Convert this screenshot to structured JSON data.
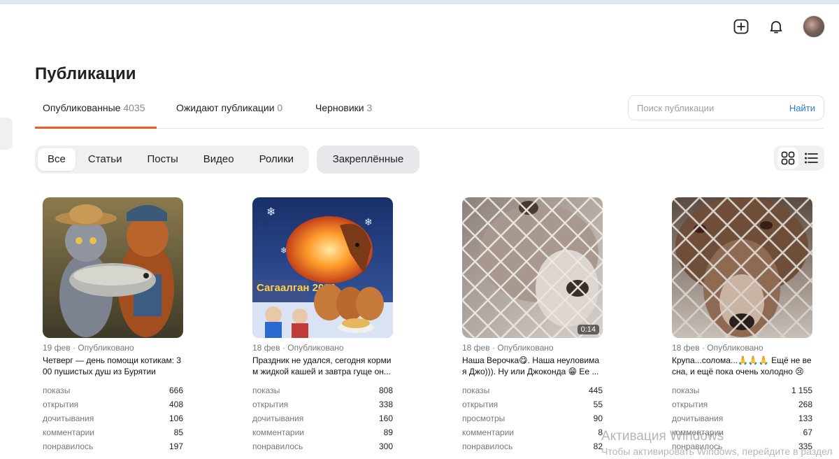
{
  "page": {
    "title": "Публикации"
  },
  "tabs": [
    {
      "label": "Опубликованные",
      "count": "4035"
    },
    {
      "label": "Ожидают публикации",
      "count": "0"
    },
    {
      "label": "Черновики",
      "count": "3"
    }
  ],
  "search": {
    "placeholder": "Поиск публикации",
    "button": "Найти"
  },
  "filters": [
    "Все",
    "Статьи",
    "Посты",
    "Видео",
    "Ролики"
  ],
  "pinned_label": "Закреплённые",
  "header_icons": [
    "add-icon",
    "bell-icon",
    "avatar"
  ],
  "accent_color": "#f25a28",
  "link_color": "#2b7bd6",
  "cards": [
    {
      "meta": "19 фев · Опубликовано",
      "caption": "Четверг — день помощи котикам: 3 00 пушистых душ из Бурятии прос...",
      "stats": [
        {
          "label": "показы",
          "value": "666"
        },
        {
          "label": "открытия",
          "value": "408"
        },
        {
          "label": "дочитывания",
          "value": "106"
        },
        {
          "label": "комментарии",
          "value": "85"
        },
        {
          "label": "понравилось",
          "value": "197"
        }
      ]
    },
    {
      "meta": "18 фев · Опубликовано",
      "caption": "Праздник не удался, сегодня корми м жидкой кашей и завтра гуще он...",
      "thumb_text": "Сагаалган 2026",
      "stats": [
        {
          "label": "показы",
          "value": "808"
        },
        {
          "label": "открытия",
          "value": "338"
        },
        {
          "label": "дочитывания",
          "value": "160"
        },
        {
          "label": "комментарии",
          "value": "89"
        },
        {
          "label": "понравилось",
          "value": "300"
        }
      ]
    },
    {
      "meta": "18 фев · Опубликовано",
      "caption": "Наша Верочка😋. Наша неуловима я Джо))). Ну или Джоконда 😁 Ее ...",
      "duration": "0:14",
      "stats": [
        {
          "label": "показы",
          "value": "445"
        },
        {
          "label": "открытия",
          "value": "55"
        },
        {
          "label": "просмотры",
          "value": "90"
        },
        {
          "label": "комментарии",
          "value": "8"
        },
        {
          "label": "понравилось",
          "value": "82"
        }
      ]
    },
    {
      "meta": "18 фев · Опубликовано",
      "caption": "Крупа...солома...🙏🙏🙏 Ещё не ве сна, и ещё пока очень холодно 😢",
      "stats": [
        {
          "label": "показы",
          "value": "1 155"
        },
        {
          "label": "открытия",
          "value": "268"
        },
        {
          "label": "дочитывания",
          "value": "133"
        },
        {
          "label": "комментарии",
          "value": "67"
        },
        {
          "label": "понравилось",
          "value": "335"
        }
      ]
    }
  ],
  "watermark": {
    "line1": "Активация Windows",
    "line2": "Чтобы активировать Windows, перейдите в раздел"
  }
}
